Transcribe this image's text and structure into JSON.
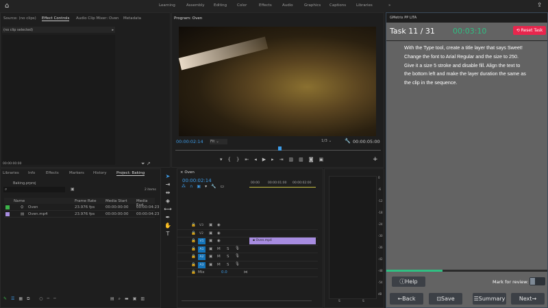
{
  "workspaces": [
    "Learning",
    "Assembly",
    "Editing",
    "Color",
    "Effects",
    "Audio",
    "Graphics",
    "Captions",
    "Libraries"
  ],
  "source_tabs": [
    "Source: (no clips)",
    "Effect Controls",
    "Audio Clip Mixer: Oven",
    "Metadata"
  ],
  "no_clip": "(no clip selected)",
  "source_time": "00:00:00:00",
  "program": {
    "title": "Program: Oven",
    "time": "00:00:02:14",
    "fit": "Fit",
    "quality": "1/3",
    "duration": "00:00:05:00"
  },
  "project_tabs": [
    "Libraries",
    "Info",
    "Effects",
    "Markers",
    "History",
    "Project: Baking"
  ],
  "project": {
    "file": "Baking.prproj",
    "items_count": "2 items",
    "columns": [
      "Name",
      "Frame Rate",
      "Media Start",
      "Media End"
    ],
    "rows": [
      {
        "name": "Oven",
        "rate": "23.976 fps",
        "start": "00:00:00:00",
        "end": "00:00:04:23",
        "color": "#3cb34a"
      },
      {
        "name": "Oven.mp4",
        "rate": "23.976 fps",
        "start": "00:00:00:00",
        "end": "00:00:04:23",
        "color": "#a78ce0"
      }
    ]
  },
  "timeline": {
    "name": "Oven",
    "time": "00:00:02:14",
    "ruler": [
      "00:00",
      "00:00:01:00",
      "00:00:02:00"
    ],
    "video_tracks": [
      "V3",
      "V2",
      "V1"
    ],
    "audio_tracks": [
      "A1",
      "A2",
      "A3"
    ],
    "mix": "Mix",
    "mix_val": "0.0",
    "clip": "Oven.mp4",
    "m": "M",
    "s": "S"
  },
  "meter": {
    "ticks": [
      "0",
      "-6",
      "-12",
      "-18",
      "-24",
      "-30",
      "-36",
      "-42",
      "-48",
      "-54",
      "dB"
    ],
    "solo": [
      "S",
      "S"
    ]
  },
  "gmetrix": {
    "title": "GMetrix PP LITA",
    "task": "Task 11 / 31",
    "timer": "00:03:10",
    "reset": "Reset Task",
    "instructions": "With the Type tool, create a title layer that says Sweet! Change the font to Arial Regular and the size to 250. Give it a size 5 stroke and disable fill. Align the text to the bottom left and make the layer duration the same as the clip in the sequence.",
    "progress": 0.35,
    "help": "Help",
    "mark": "Mark for review:",
    "back": "Back",
    "save": "Save",
    "summary": "Summary",
    "next": "Next",
    "accent": "#e8264d",
    "timer_color": "#2fbf82"
  }
}
